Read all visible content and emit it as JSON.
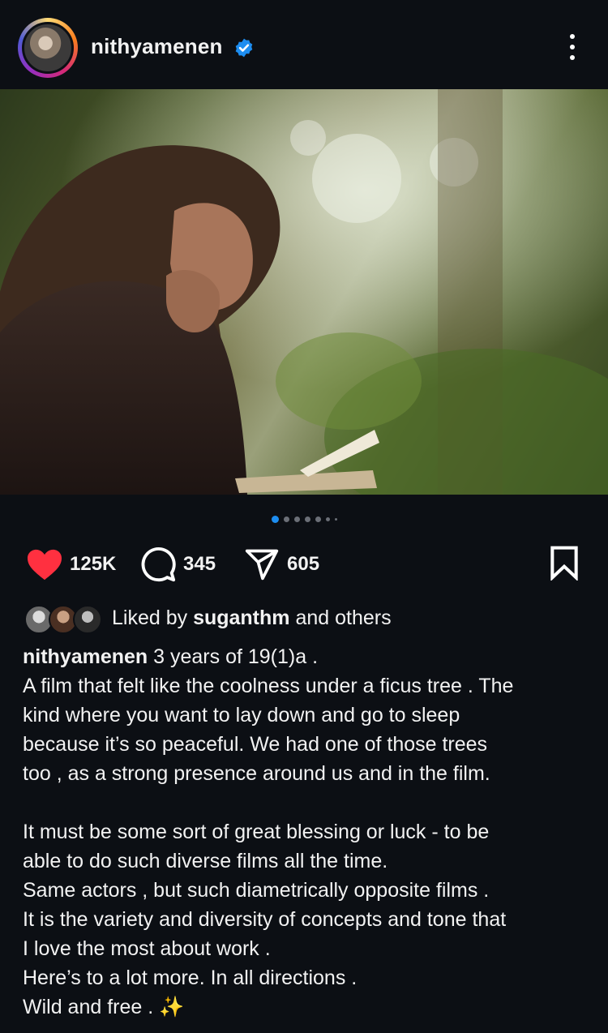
{
  "post": {
    "username": "nithyamenen",
    "verified_icon": "verified-badge-icon",
    "more_icon": "more-vertical-icon"
  },
  "carousel": {
    "total_dots": 7,
    "active_index": 0
  },
  "actions": {
    "likes": "125K",
    "comments": "345",
    "shares": "605",
    "like_icon": "heart-icon",
    "comment_icon": "comment-icon",
    "share_icon": "send-icon",
    "save_icon": "bookmark-icon",
    "like_color": "#ff3040"
  },
  "liked_by": {
    "prefix": "Liked by ",
    "user": "suganthm",
    "suffix": " and others"
  },
  "caption": {
    "username": "nithyamenen",
    "first_line": " 3 years of 19(1)a .",
    "lines": [
      "A film that felt like the coolness under a ficus tree . The",
      "kind where you want to lay down and go to sleep",
      "because it’s so peaceful. We had one of those trees",
      "too , as a strong presence around us and in the film."
    ],
    "lines2": [
      "It must be some sort of great blessing or luck - to be",
      "able to do such diverse films all the time.",
      "Same actors , but such diametrically opposite films .",
      "It is the variety and diversity of concepts and tone that",
      "I love the most about work .",
      "Here’s to a lot more. In all directions .",
      "Wild and free . ✨"
    ]
  }
}
